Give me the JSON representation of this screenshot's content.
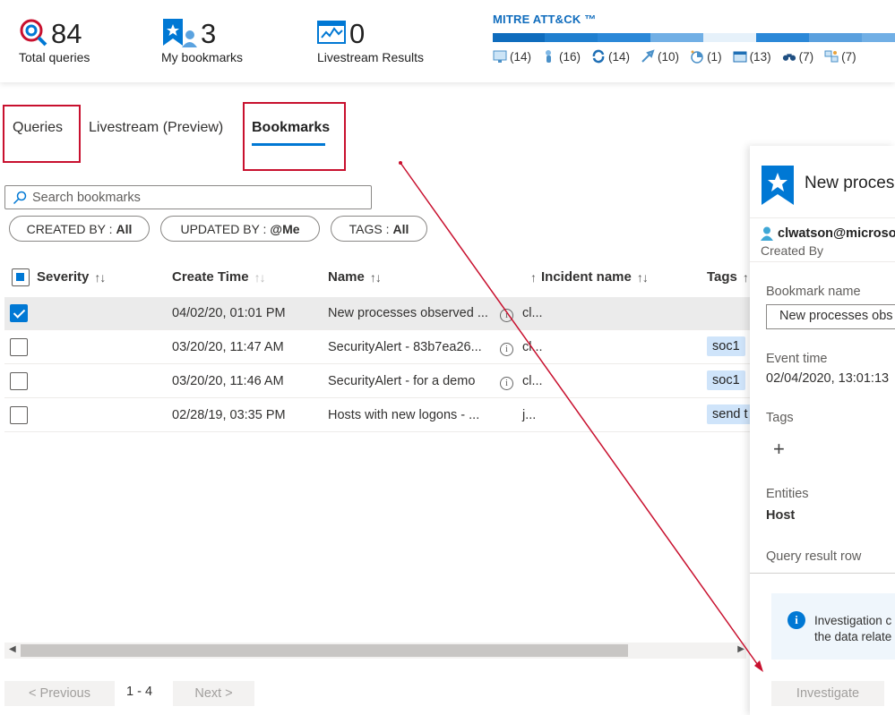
{
  "stats": [
    {
      "value": "84",
      "label": "Total queries",
      "icon": "target-search-icon"
    },
    {
      "value": "3",
      "label": "My bookmarks",
      "icon": "bookmark-user-icon"
    },
    {
      "value": "0",
      "label": "Livestream Results",
      "icon": "livestream-monitor-icon"
    }
  ],
  "mitre": {
    "title": "MITRE ATT&CK ™",
    "bar_colors": [
      "#0f6cbd",
      "#1f7fcf",
      "#2b88d8",
      "#71afe5",
      "#e6f1fa",
      "#2b88d8",
      "#5aa0de",
      "#71afe5"
    ],
    "tactics": [
      {
        "icon": "initial-access-icon",
        "count": "(14)"
      },
      {
        "icon": "execution-icon",
        "count": "(16)"
      },
      {
        "icon": "persistence-icon",
        "count": "(14)"
      },
      {
        "icon": "privilege-escalation-icon",
        "count": "(10)"
      },
      {
        "icon": "defense-evasion-icon",
        "count": "(1)"
      },
      {
        "icon": "credential-access-icon",
        "count": "(13)"
      },
      {
        "icon": "discovery-icon",
        "count": "(7)"
      },
      {
        "icon": "lateral-movement-icon",
        "count": "(7)"
      }
    ]
  },
  "tabs": [
    {
      "label": "Queries"
    },
    {
      "label": "Livestream (Preview)"
    },
    {
      "label": "Bookmarks"
    }
  ],
  "search": {
    "placeholder": "Search bookmarks"
  },
  "filters": [
    {
      "key": "CREATED BY :",
      "value": "All"
    },
    {
      "key": "UPDATED BY :",
      "value": "@Me"
    },
    {
      "key": "TAGS :",
      "value": "All"
    }
  ],
  "table": {
    "columns": [
      "Severity",
      "Create Time",
      "Name",
      "Incident name",
      "Tags"
    ],
    "rows": [
      {
        "checked": true,
        "time": "04/02/20, 01:01 PM",
        "name": "New processes observed ...",
        "incident": "cl...",
        "tag": ""
      },
      {
        "checked": false,
        "time": "03/20/20, 11:47 AM",
        "name": "SecurityAlert - 83b7ea26...",
        "incident": "cl...",
        "tag": "soc1"
      },
      {
        "checked": false,
        "time": "03/20/20, 11:46 AM",
        "name": "SecurityAlert - for a demo",
        "incident": "cl...",
        "tag": "soc1"
      },
      {
        "checked": false,
        "time": "02/28/19, 03:35 PM",
        "name": "Hosts with new logons - ...",
        "incident": "j...",
        "tag": "send t"
      }
    ]
  },
  "pager": {
    "prev": "< Previous",
    "info": "1 - 4",
    "next": "Next >"
  },
  "details": {
    "title": "New proces",
    "user": "clwatson@microso",
    "created_by_label": "Created By",
    "bookmark_name_label": "Bookmark name",
    "bookmark_name_value": "New processes obs",
    "event_time_label": "Event time",
    "event_time_value": "02/04/2020, 13:01:13",
    "tags_label": "Tags",
    "tags_add": "+",
    "entities_label": "Entities",
    "entities_value": "Host",
    "query_row_label": "Query result row",
    "info_line1": "Investigation c",
    "info_line2": "the data relate",
    "investigate_label": "Investigate"
  }
}
